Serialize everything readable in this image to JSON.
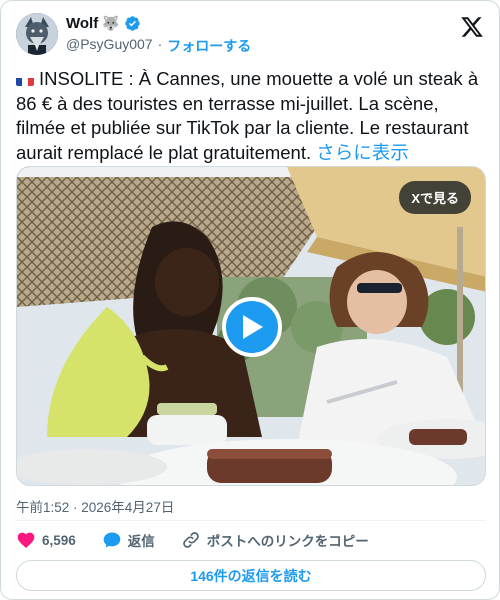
{
  "author": {
    "name": "Wolf",
    "name_emoji": "🐺",
    "handle": "@PsyGuy007",
    "separator": "·",
    "follow_label": "フォローする",
    "verified": true
  },
  "tweet": {
    "flag": "france-flag",
    "text": "INSOLITE : À Cannes, une mouette a volé un steak à 86 € à des touristes en terrasse mi-juillet. La scène, filmée et publiée sur TikTok par la cliente. Le restaurant aurait remplacé le plat gratuitement.",
    "more_label": "さらに表示"
  },
  "media": {
    "view_on_x_label": "Xで見る",
    "type": "video"
  },
  "timestamp": "午前1:52 · 2026年4月27日",
  "actions": {
    "likes_count": "6,596",
    "reply_label": "返信",
    "copy_link_label": "ポストへのリンクをコピー"
  },
  "read_replies_label": "146件の返信を読む",
  "colors": {
    "accent": "#1d9bf0",
    "like": "#f91880",
    "text_primary": "#0f1419",
    "text_secondary": "#536471"
  }
}
